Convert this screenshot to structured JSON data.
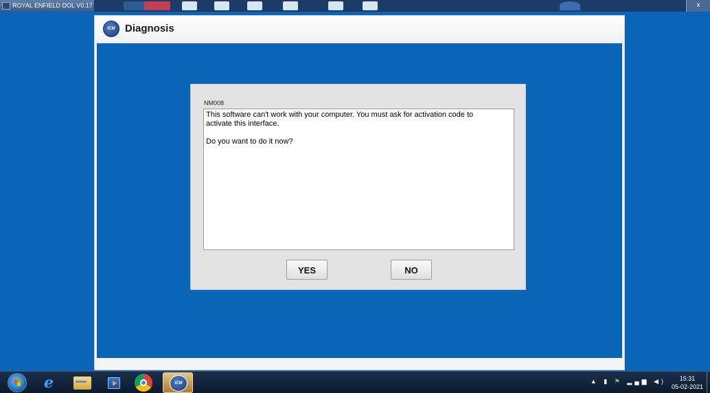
{
  "titlebar": {
    "app_name": "ROYAL ENFIELD DOL V0.17",
    "close_label": "x"
  },
  "app": {
    "title": "Diagnosis",
    "logo_text": "ICM"
  },
  "dialog": {
    "code": "NM008",
    "message": "This software can't work with your computer. You must ask for activation code to\nactivate this interface.\n\nDo you want to do it now?",
    "yes_label": "YES",
    "no_label": "NO"
  },
  "taskbar": {
    "pinned": [
      "start-icon",
      "internet-explorer-icon",
      "file-explorer-icon",
      "media-player-icon",
      "chrome-icon",
      "icm-diagnosis-icon"
    ],
    "tray_icons": [
      "show-hidden-icons",
      "battery-icon",
      "network-flag-icon",
      "signal-icon",
      "volume-icon"
    ],
    "time": "15:31",
    "date": "05-02-2021"
  }
}
